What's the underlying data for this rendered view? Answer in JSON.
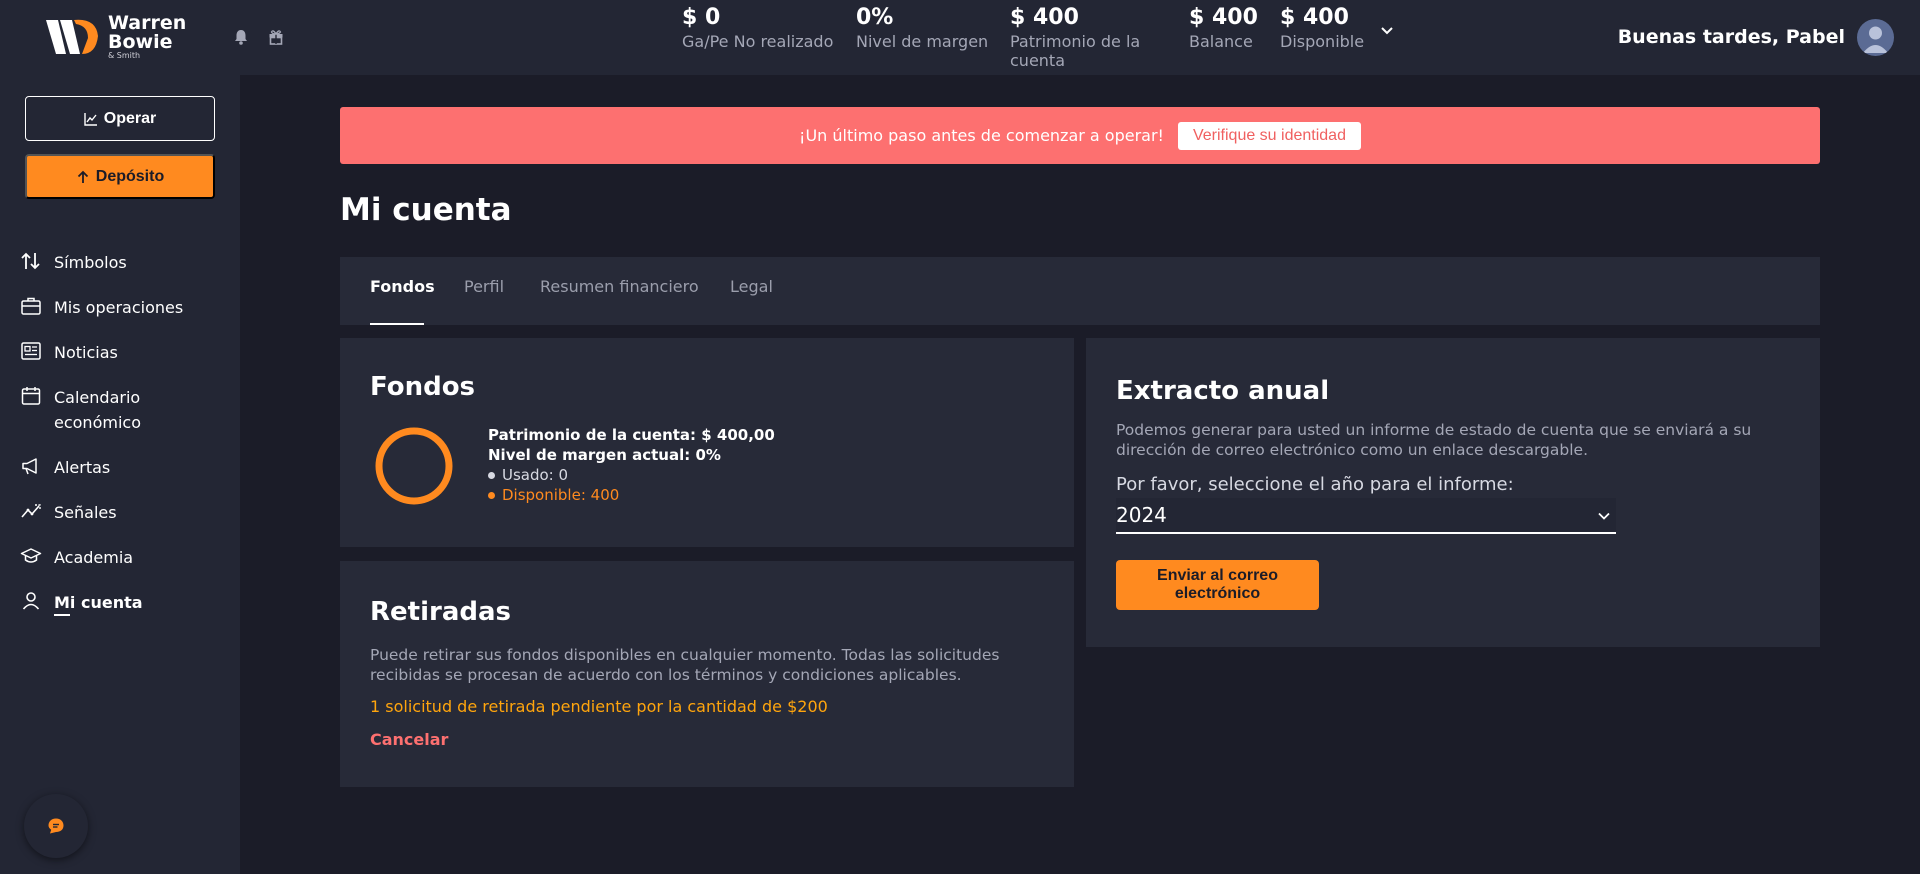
{
  "brand": {
    "line1": "Warren",
    "line2": "Bowie",
    "line3": "& Smith"
  },
  "header": {
    "stats": [
      {
        "value": "$ 0",
        "label": "Ga/Pe No realizado"
      },
      {
        "value": "0%",
        "label": "Nivel de margen"
      },
      {
        "value": "$ 400",
        "label": "Patrimonio de la cuenta"
      },
      {
        "value": "$ 400",
        "label": "Balance"
      },
      {
        "value": "$ 400",
        "label": "Disponible"
      }
    ],
    "greeting": "Buenas tardes, Pabel"
  },
  "sidebar": {
    "operar_label": "Operar",
    "deposito_label": "Depósito",
    "items": [
      {
        "label": "Símbolos",
        "icon": "arrows-updown-icon"
      },
      {
        "label": "Mis operaciones",
        "icon": "briefcase-icon"
      },
      {
        "label": "Noticias",
        "icon": "newspaper-icon"
      },
      {
        "label": "Calendario económico",
        "icon": "calendar-icon"
      },
      {
        "label": "Alertas",
        "icon": "megaphone-icon"
      },
      {
        "label": "Señales",
        "icon": "signal-chart-icon"
      },
      {
        "label": "Academia",
        "icon": "graduation-cap-icon"
      },
      {
        "label": "Mi cuenta",
        "icon": "user-icon"
      }
    ]
  },
  "banner": {
    "message": "¡Un último paso antes de comenzar a operar!",
    "button": "Verifique su identidad"
  },
  "page": {
    "title": "Mi cuenta",
    "tabs": [
      "Fondos",
      "Perfil",
      "Resumen financiero",
      "Legal"
    ]
  },
  "funds": {
    "title": "Fondos",
    "equity_line": "Patrimonio de la cuenta: $ 400,00",
    "margin_line": "Nivel de margen actual: 0%",
    "used_line": "Usado: 0",
    "available_line": "Disponible: 400",
    "used_value": 0,
    "available_value": 400
  },
  "withdrawals": {
    "title": "Retiradas",
    "description_1": "Puede retirar sus fondos disponibles en cualquier momento. Todas las solicitudes",
    "description_2": "recibidas se procesan de acuerdo con los términos y condiciones aplicables.",
    "pending": "1 solicitud de retirada pendiente por la cantidad de $200",
    "cancel": "Cancelar"
  },
  "statement": {
    "title": "Extracto anual",
    "description_1": "Podemos generar para usted un informe de estado de cuenta que se enviará a su",
    "description_2": "dirección de correo electrónico como un enlace descargable.",
    "select_label": "Por favor, seleccione el año para el informe:",
    "select_value": "2024",
    "send_line1": "Enviar al correo",
    "send_line2": "electrónico"
  },
  "colors": {
    "accent": "#ff8a1f",
    "banner": "#fd7070",
    "pending": "#ffa50d",
    "background": "#1b1c28",
    "panel": "#272a38"
  }
}
